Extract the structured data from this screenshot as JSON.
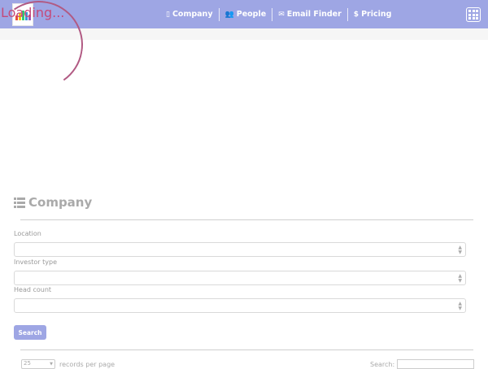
{
  "loading": {
    "text": "Loading..."
  },
  "navbar": {
    "background": "#9ea6e4",
    "logo_icon": "colorful-bar-logo",
    "links": [
      {
        "icon": "building-icon",
        "label": "Company"
      },
      {
        "icon": "users-icon",
        "label": "People"
      },
      {
        "icon": "envelope-icon",
        "label": "Email Finder"
      },
      {
        "icon": "dollar-icon",
        "label": "Pricing"
      }
    ],
    "apps_icon": "grid-icon"
  },
  "section": {
    "icon": "list-icon",
    "title": "Company"
  },
  "filters": [
    {
      "label": "Location",
      "value": ""
    },
    {
      "label": "Investor type",
      "value": ""
    },
    {
      "label": "Head count",
      "value": ""
    }
  ],
  "search_button": {
    "label": "Search",
    "color": "#9ea6e4"
  },
  "table_controls": {
    "page_size": "25",
    "page_size_suffix": "records per page",
    "search_label": "Search:"
  }
}
